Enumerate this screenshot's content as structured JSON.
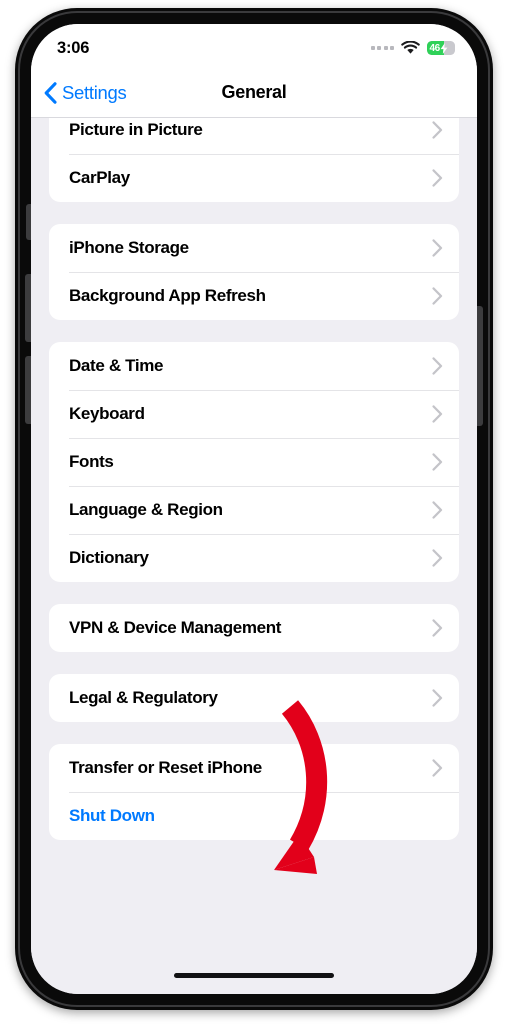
{
  "status_bar": {
    "time": "3:06",
    "signal_dots": 4,
    "wifi_icon": "wifi-icon",
    "battery": {
      "percent_label": "46",
      "charging": true,
      "fill_color": "#2fd158",
      "track_color": "#c9c9ce"
    }
  },
  "nav_bar": {
    "back_icon": "chevron-left-icon",
    "back_label": "Settings",
    "title": "General",
    "accent_color": "#007aff"
  },
  "groups": [
    {
      "id": "media-group",
      "clipped_top": true,
      "rows": [
        {
          "label": "Picture in Picture",
          "accessory": "chevron-right-icon",
          "style": "default"
        },
        {
          "label": "CarPlay",
          "accessory": "chevron-right-icon",
          "style": "default"
        }
      ]
    },
    {
      "id": "storage-group",
      "clipped_top": false,
      "rows": [
        {
          "label": "iPhone Storage",
          "accessory": "chevron-right-icon",
          "style": "default"
        },
        {
          "label": "Background App Refresh",
          "accessory": "chevron-right-icon",
          "style": "default"
        }
      ]
    },
    {
      "id": "localization-group",
      "clipped_top": false,
      "rows": [
        {
          "label": "Date & Time",
          "accessory": "chevron-right-icon",
          "style": "default"
        },
        {
          "label": "Keyboard",
          "accessory": "chevron-right-icon",
          "style": "default"
        },
        {
          "label": "Fonts",
          "accessory": "chevron-right-icon",
          "style": "default"
        },
        {
          "label": "Language & Region",
          "accessory": "chevron-right-icon",
          "style": "default"
        },
        {
          "label": "Dictionary",
          "accessory": "chevron-right-icon",
          "style": "default"
        }
      ]
    },
    {
      "id": "vpn-group",
      "clipped_top": false,
      "rows": [
        {
          "label": "VPN & Device Management",
          "accessory": "chevron-right-icon",
          "style": "default"
        }
      ]
    },
    {
      "id": "legal-group",
      "clipped_top": false,
      "rows": [
        {
          "label": "Legal & Regulatory",
          "accessory": "chevron-right-icon",
          "style": "default"
        }
      ]
    },
    {
      "id": "reset-group",
      "clipped_top": false,
      "rows": [
        {
          "label": "Transfer or Reset iPhone",
          "accessory": "chevron-right-icon",
          "style": "default"
        },
        {
          "label": "Shut Down",
          "accessory": "none",
          "style": "link"
        }
      ]
    }
  ],
  "annotation": {
    "type": "curved-arrow",
    "color": "#e2001a",
    "points_to": "Transfer or Reset iPhone"
  },
  "home_indicator": {
    "visible": true
  }
}
